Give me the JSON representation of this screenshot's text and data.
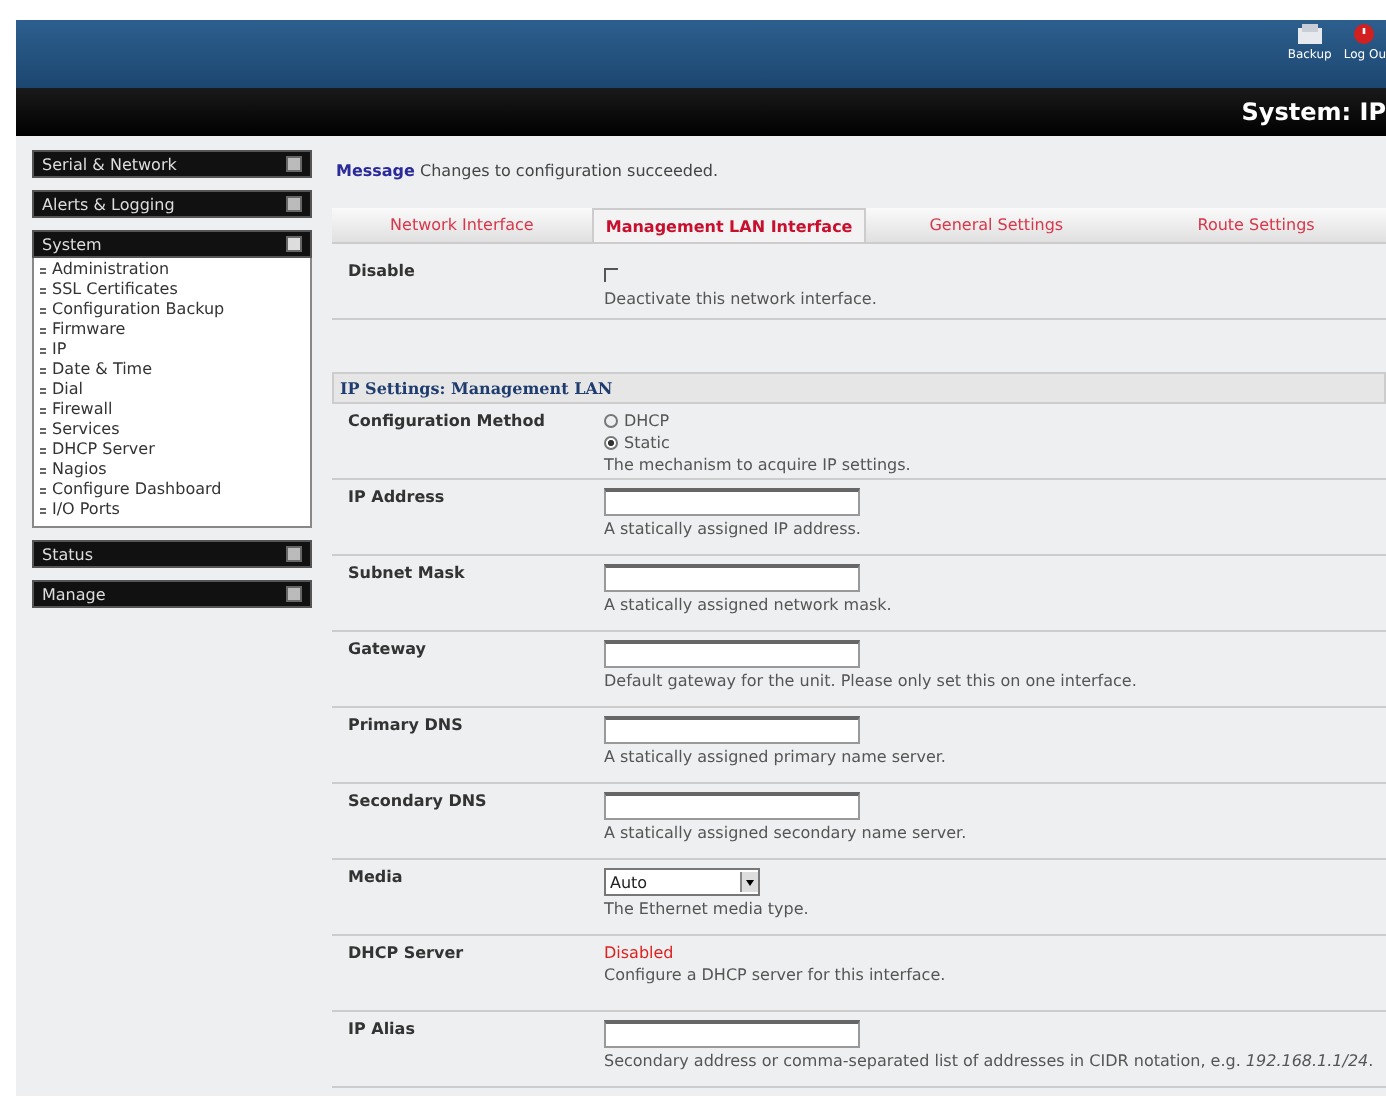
{
  "header": {
    "actions": [
      {
        "kind": "backup",
        "label": "Backup"
      },
      {
        "kind": "logout",
        "label": "Log Ou"
      }
    ],
    "title": "System: IP"
  },
  "sidebar": [
    {
      "label": "Serial & Network",
      "expanded": false
    },
    {
      "label": "Alerts & Logging",
      "expanded": false
    },
    {
      "label": "System",
      "expanded": true,
      "children": [
        {
          "label": "Administration"
        },
        {
          "label": "SSL Certificates"
        },
        {
          "label": "Configuration Backup"
        },
        {
          "label": "Firmware"
        },
        {
          "label": "IP"
        },
        {
          "label": "Date & Time"
        },
        {
          "label": "Dial"
        },
        {
          "label": "Firewall"
        },
        {
          "label": "Services"
        },
        {
          "label": "DHCP Server"
        },
        {
          "label": "Nagios"
        },
        {
          "label": "Configure Dashboard"
        },
        {
          "label": "I/O Ports"
        }
      ]
    },
    {
      "label": "Status",
      "expanded": false
    },
    {
      "label": "Manage",
      "expanded": false
    }
  ],
  "message": {
    "label": "Message",
    "text": "Changes to configuration succeeded."
  },
  "tabs": [
    {
      "label": "Network Interface",
      "selected": false
    },
    {
      "label": "Management LAN Interface",
      "selected": true
    },
    {
      "label": "General Settings",
      "selected": false
    },
    {
      "label": "Route Settings",
      "selected": false
    }
  ],
  "top_rows": [
    {
      "kind": "checkbox",
      "label": "Disable",
      "checked": false,
      "help": "Deactivate this network interface."
    }
  ],
  "section_title": "IP Settings: Management LAN",
  "rows": [
    {
      "kind": "radio",
      "label": "Configuration Method",
      "options": [
        {
          "label": "DHCP",
          "selected": false
        },
        {
          "label": "Static",
          "selected": true
        }
      ],
      "help": "The mechanism to acquire IP settings."
    },
    {
      "kind": "text",
      "label": "IP Address",
      "help": "A statically assigned IP address."
    },
    {
      "kind": "text",
      "label": "Subnet Mask",
      "help": "A statically assigned network mask."
    },
    {
      "kind": "text",
      "label": "Gateway",
      "help": "Default gateway for the unit. Please only set this on one interface."
    },
    {
      "kind": "text",
      "label": "Primary DNS",
      "help": "A statically assigned primary name server."
    },
    {
      "kind": "text",
      "label": "Secondary DNS",
      "help": "A statically assigned secondary name server."
    },
    {
      "kind": "select",
      "label": "Media",
      "value": "Auto",
      "help": "The Ethernet media type."
    },
    {
      "kind": "status",
      "label": "DHCP Server",
      "value": "Disabled",
      "help": "Configure a DHCP server for this interface."
    },
    {
      "kind": "text",
      "label": "IP Alias",
      "help": "Secondary address or comma-separated list of addresses in CIDR notation, e.g. *192.168.1.1/24*."
    }
  ]
}
